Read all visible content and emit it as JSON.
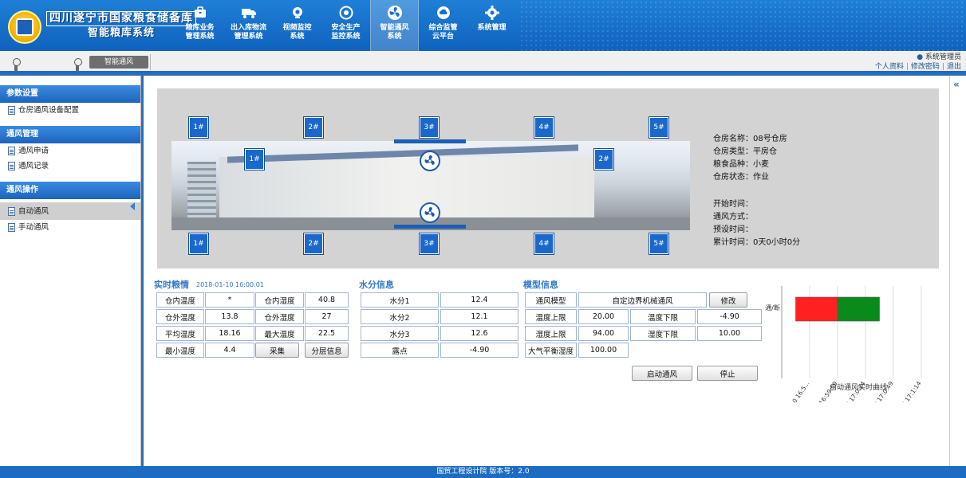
{
  "header": {
    "title_line1": "四川遂宁市国家粮食储备库",
    "title_line2": "智能粮库系统",
    "nav": [
      {
        "label": "粮库业务\n管理系统",
        "icon": "briefcase-icon"
      },
      {
        "label": "出入库物流\n管理系统",
        "icon": "truck-icon"
      },
      {
        "label": "视频监控\n系统",
        "icon": "camera-icon"
      },
      {
        "label": "安全生产\n监控系统",
        "icon": "shield-gear-icon"
      },
      {
        "label": "智能通风\n系统",
        "icon": "fan-icon",
        "active": true
      },
      {
        "label": "综合监管\n云平台",
        "icon": "cloud-icon"
      },
      {
        "label": "系统管理",
        "icon": "gear-icon"
      }
    ]
  },
  "toolbar": {
    "tab_label": "智能通风",
    "user_name": "系统管理员",
    "links": [
      "个人资料",
      "修改密码",
      "退出"
    ]
  },
  "sidebar": {
    "groups": [
      {
        "title": "参数设置",
        "items": [
          {
            "label": "仓房通风设备配置"
          }
        ]
      },
      {
        "title": "通风管理",
        "items": [
          {
            "label": "通风申请"
          },
          {
            "label": "通风记录"
          }
        ]
      },
      {
        "title": "通风操作",
        "items": [
          {
            "label": "自动通风",
            "active": true
          },
          {
            "label": "手动通风"
          }
        ]
      }
    ]
  },
  "vents": {
    "top": [
      "1#",
      "2#",
      "3#",
      "4#",
      "5#"
    ],
    "bottom": [
      "1#",
      "2#",
      "3#",
      "4#",
      "5#"
    ],
    "side_left": "1#",
    "side_right": "2#"
  },
  "warehouse_info": {
    "name_label": "仓房名称：",
    "name": "08号仓房",
    "type_label": "仓房类型：",
    "type": "平房仓",
    "grain_label": "粮食品种：",
    "grain": "小麦",
    "status_label": "仓房状态：",
    "status": "作业",
    "start_label": "开始时间：",
    "start": "",
    "mode_label": "通风方式：",
    "mode": "",
    "preset_label": "预设时间：",
    "preset": "",
    "total_label": "累计时间：",
    "total": "0天0小时0分"
  },
  "realtime": {
    "title": "实时粮情",
    "time": "2018-01-10 16:00:01",
    "rows": [
      [
        "仓内温度",
        "*",
        "仓内湿度",
        "40.8"
      ],
      [
        "仓外温度",
        "13.8",
        "仓外湿度",
        "27"
      ],
      [
        "平均温度",
        "18.16",
        "最大温度",
        "22.5"
      ],
      [
        "最小温度",
        "4.4"
      ]
    ],
    "collect_button": "采集",
    "layer_button": "分层信息"
  },
  "moisture": {
    "title": "水分信息",
    "rows": [
      [
        "水分1",
        "12.4"
      ],
      [
        "水分2",
        "12.1"
      ],
      [
        "水分3",
        "12.6"
      ],
      [
        "露点",
        "-4.90"
      ]
    ]
  },
  "model": {
    "title": "模型信息",
    "model_label": "通风模型",
    "model_value": "自定边界机械通风",
    "edit_button": "修改",
    "rows": [
      [
        "温度上限",
        "20.00",
        "温度下限",
        "-4.90"
      ],
      [
        "湿度上限",
        "94.00",
        "湿度下限",
        "10.00"
      ]
    ],
    "eq_label": "大气平衡湿度",
    "eq_value": "100.00",
    "start_button": "启动通风",
    "stop_button": "停止"
  },
  "chart_data": {
    "type": "bar",
    "orientation": "horizontal",
    "categories": [
      "通/断"
    ],
    "x_ticks": [
      "1-10 16:5...",
      "1-10 16:59:59",
      "1-10 17:0:24",
      "1-10 17:0:49",
      "1-10 17:1:14"
    ],
    "segments": [
      {
        "start_tick": 0.5,
        "end_tick": 2,
        "color": "#ff2020"
      },
      {
        "start_tick": 2,
        "end_tick": 3.5,
        "color": "#0a8a1a"
      }
    ],
    "caption": "自动通风实时曲线"
  },
  "footer": {
    "text": "国贸工程设计院   版本号：2.0"
  }
}
